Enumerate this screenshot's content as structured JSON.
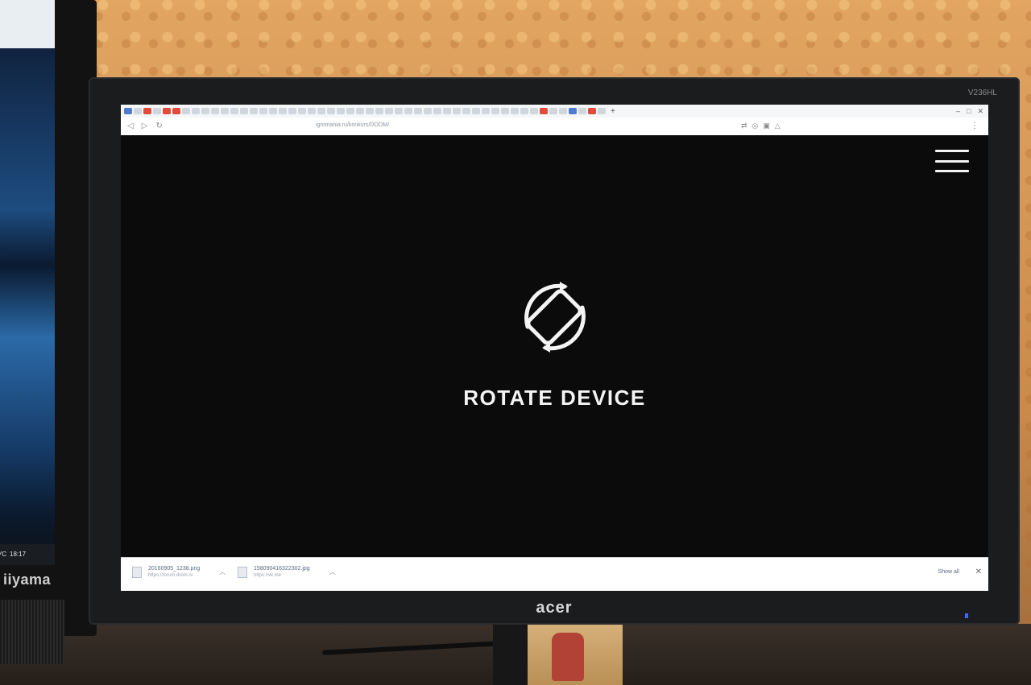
{
  "left_monitor": {
    "brand": "iiyama",
    "taskbar_lang": "РУС",
    "taskbar_time": "18:17"
  },
  "main_monitor": {
    "brand": "acer",
    "model": "V236HL"
  },
  "browser": {
    "url": "igromania.ru/konkurs/DOOM/",
    "new_tab_symbol": "+",
    "nav": {
      "back_symbol": "◁",
      "forward_symbol": "▷",
      "reload_symbol": "↻"
    },
    "menu_symbol": "⋮"
  },
  "page": {
    "message": "ROTATE DEVICE",
    "menu_icon": "hamburger-icon",
    "rotate_icon": "rotate-device-icon"
  },
  "downloads": {
    "items": [
      {
        "name": "20160905_1238.png",
        "source": "https://forum.drom.ru"
      },
      {
        "name": "158090416322302.jpg",
        "source": "https://vk.me"
      }
    ],
    "show_all": "Show all",
    "close_symbol": "✕"
  },
  "colors": {
    "page_background": "#0b0b0c",
    "text": "#f4f4f4"
  }
}
